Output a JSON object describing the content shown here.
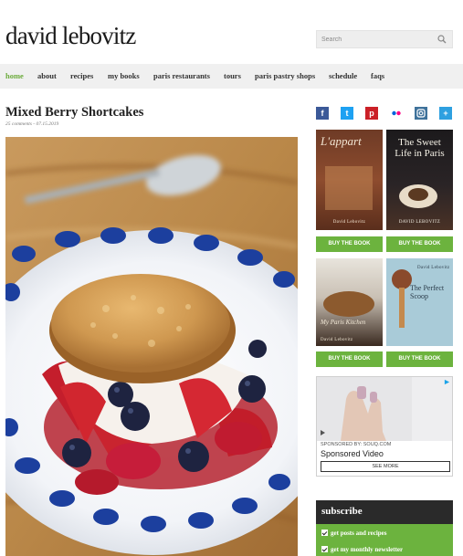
{
  "site": {
    "logo": "david lebovitz"
  },
  "search": {
    "placeholder": "Search"
  },
  "nav": {
    "items": [
      "home",
      "about",
      "recipes",
      "my books",
      "paris restaurants",
      "tours",
      "paris pastry shops",
      "schedule",
      "faqs"
    ],
    "active": "home"
  },
  "post": {
    "title": "Mixed Berry Shortcakes",
    "meta": "25 comments - 07.15.2019"
  },
  "social": [
    {
      "icon": "facebook-icon",
      "glyph": "f",
      "color": "#3b5998"
    },
    {
      "icon": "twitter-icon",
      "glyph": "t",
      "color": "#1da1f2"
    },
    {
      "icon": "pinterest-icon",
      "glyph": "p",
      "color": "#cb2027"
    },
    {
      "icon": "flickr-icon",
      "glyph": "••",
      "color": "#ffffff"
    },
    {
      "icon": "instagram-icon",
      "glyph": "◘",
      "color": "#3f729b"
    },
    {
      "icon": "plus-icon",
      "glyph": "+",
      "color": "#2ea0e0"
    }
  ],
  "books": [
    {
      "title": "L'appart",
      "author": "David Lebovitz",
      "button": "BUY THE BOOK"
    },
    {
      "title": "The Sweet Life in Paris",
      "author": "DAVID LEBOVITZ",
      "button": "BUY THE BOOK"
    },
    {
      "title": "My Paris Kitchen",
      "author": "David Lebovitz",
      "button": "BUY THE BOOK"
    },
    {
      "title": "The Perfect Scoop",
      "author": "David Lebovitz",
      "button": "BUY THE BOOK"
    }
  ],
  "ad": {
    "sponsor": "SPONSORED BY: SOUQ.COM",
    "headline": "Sponsored Video",
    "cta": "SEE MORE"
  },
  "subscribe": {
    "title": "subscribe",
    "options": [
      "get posts and recipes",
      "get my monthly newsletter"
    ]
  },
  "colors": {
    "accent_green": "#6cb33e",
    "nav_active": "#6cab3c",
    "nav_bg": "#f0f0f0",
    "subscribe_head": "#2a2a2a"
  }
}
